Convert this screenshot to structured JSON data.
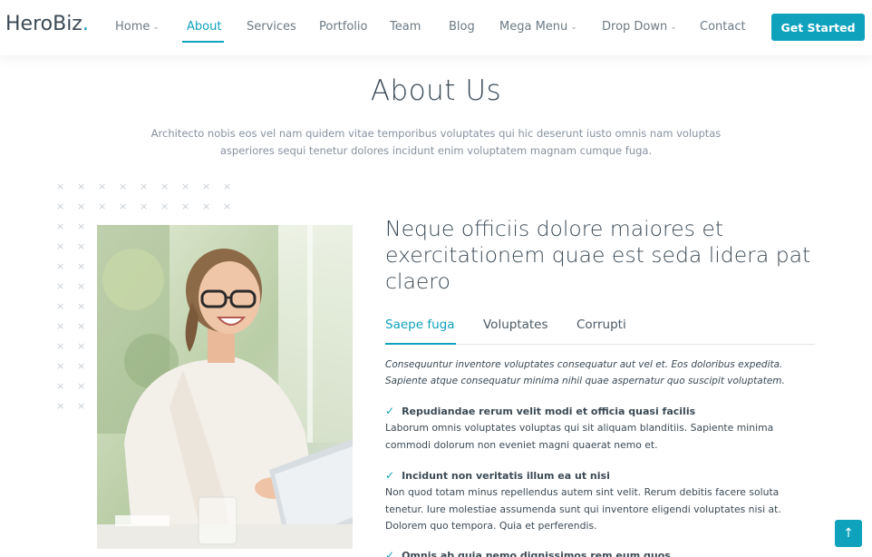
{
  "header": {
    "logo_text": "HeroBiz",
    "logo_dot": ".",
    "nav": [
      {
        "label": "Home",
        "dropdown": true
      },
      {
        "label": "About",
        "dropdown": false,
        "active": true
      },
      {
        "label": "Services",
        "dropdown": false
      },
      {
        "label": "Portfolio",
        "dropdown": false
      },
      {
        "label": "Team",
        "dropdown": false
      },
      {
        "label": "Blog",
        "dropdown": false
      },
      {
        "label": "Mega Menu",
        "dropdown": true
      },
      {
        "label": "Drop Down",
        "dropdown": true
      },
      {
        "label": "Contact",
        "dropdown": false
      }
    ],
    "cta_label": "Get Started"
  },
  "section": {
    "title": "About Us",
    "subtitle": "Architecto nobis eos vel nam quidem vitae temporibus voluptates qui hic deserunt iusto omnis nam voluptas asperiores sequi tenetur dolores incidunt enim voluptatem magnam cumque fuga."
  },
  "content": {
    "heading": "Neque officiis dolore maiores et exercitationem quae est seda lidera pat claero",
    "tabs": [
      {
        "label": "Saepe fuga",
        "active": true
      },
      {
        "label": "Voluptates",
        "active": false
      },
      {
        "label": "Corrupti",
        "active": false
      }
    ],
    "intro": "Consequuntur inventore voluptates consequatur aut vel et. Eos doloribus expedita. Sapiente atque consequatur minima nihil quae aspernatur quo suscipit voluptatem.",
    "features": [
      {
        "title": "Repudiandae rerum velit modi et officia quasi facilis",
        "text": "Laborum omnis voluptates voluptas qui sit aliquam blanditiis. Sapiente minima commodi dolorum non eveniet magni quaerat nemo et."
      },
      {
        "title": "Incidunt non veritatis illum ea ut nisi",
        "text": "Non quod totam minus repellendus autem sint velit. Rerum debitis facere soluta tenetur. Iure molestiae assumenda sunt qui inventore eligendi voluptates nisi at. Dolorem quo tempora. Quia et perferendis."
      },
      {
        "title": "Omnis ab quia nemo dignissimos rem eum quos",
        "text": ""
      }
    ]
  },
  "icons": {
    "check": "✓",
    "chevron": "⌄",
    "back_to_top": "↑",
    "dot_mark": "×"
  },
  "colors": {
    "accent": "#0ea2bd",
    "heading": "#3b4a56",
    "muted": "#8792a0"
  }
}
